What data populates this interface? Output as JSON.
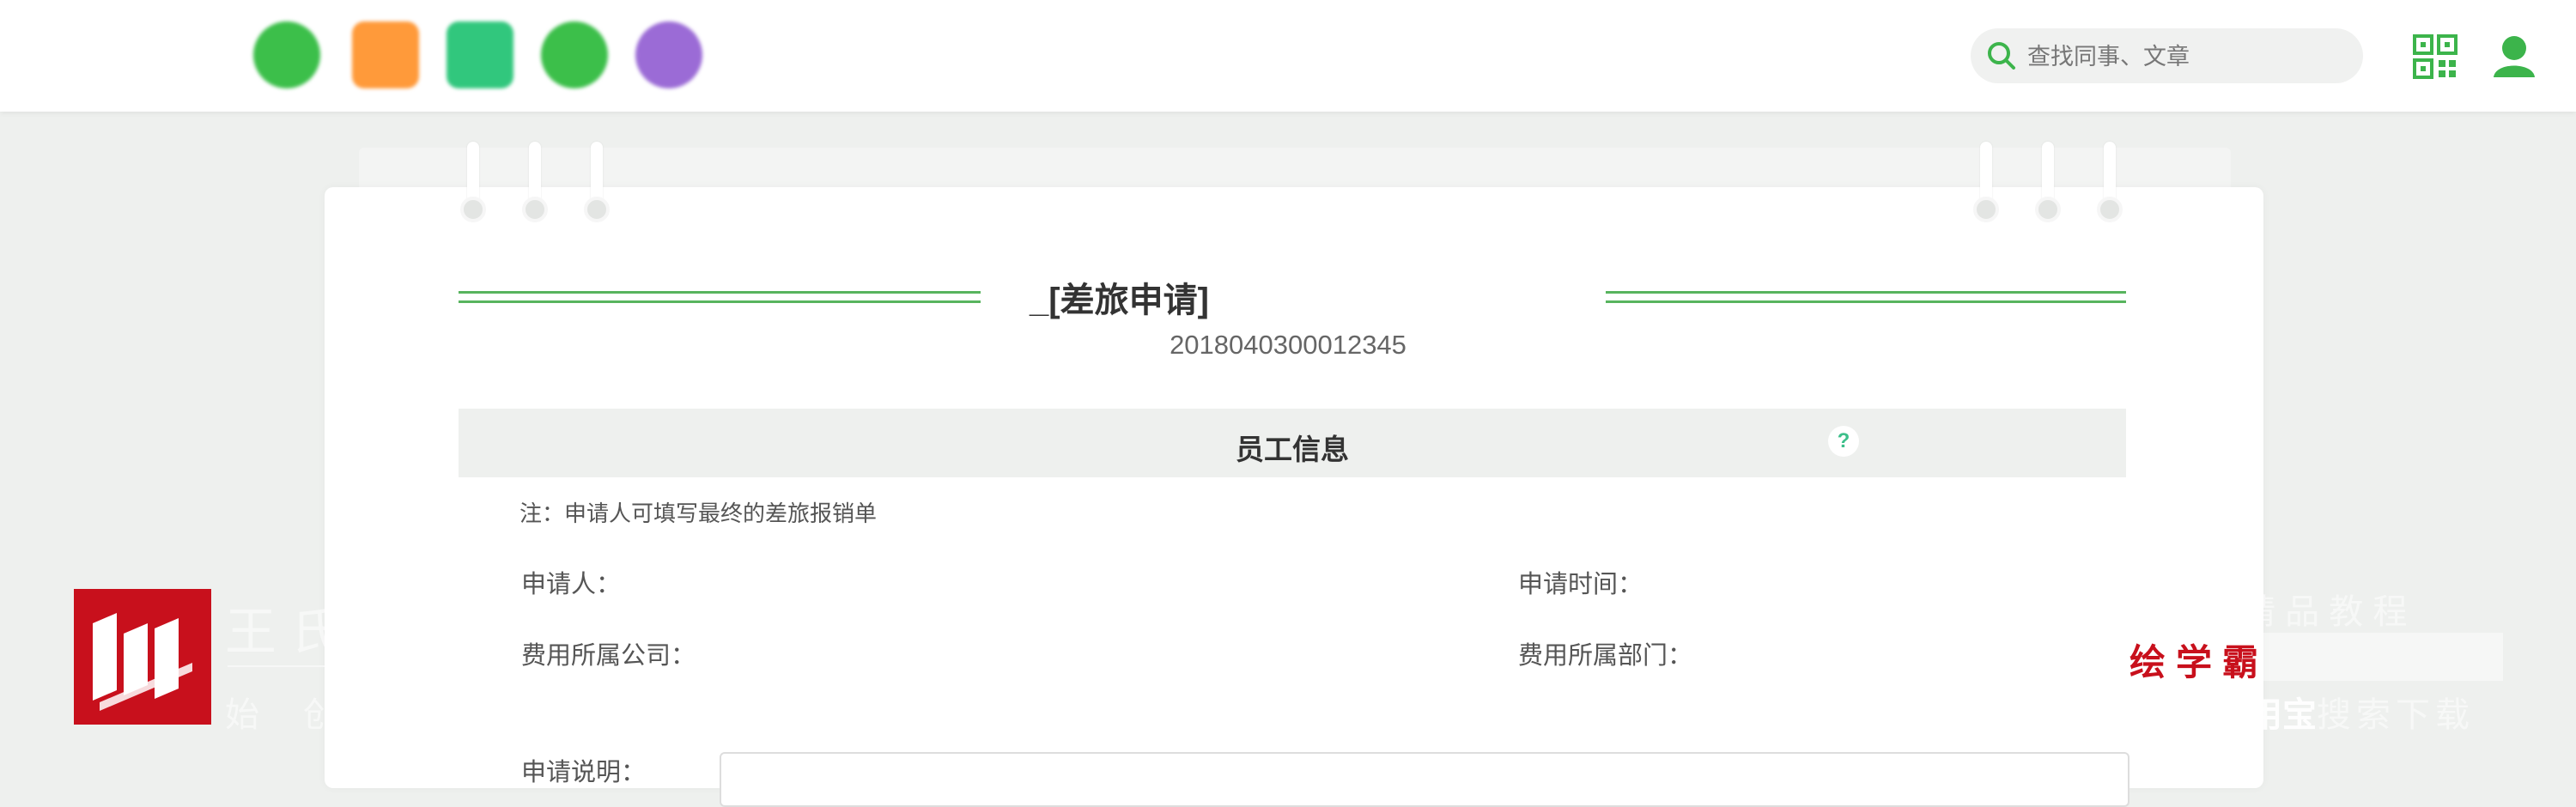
{
  "header": {
    "logo_text": "",
    "tagline": "",
    "tagline_highlight": "",
    "search_placeholder": "查找同事、文章"
  },
  "document": {
    "title_blurred": "",
    "title_suffix": "_[差旅申请]",
    "number": "2018040300012345"
  },
  "section": {
    "title": "员工信息",
    "help_symbol": "?"
  },
  "note": "注：申请人可填写最终的差旅报销单",
  "fields": {
    "applicant_label": "申请人：",
    "applicant_value": "",
    "apply_time_label": "申请时间：",
    "apply_time_value": "",
    "company_label": "费用所属公司：",
    "company_value": "",
    "company_value_2": "",
    "department_label": "费用所属部门：",
    "department_value": "",
    "description_label": "申请说明："
  },
  "watermark": {
    "title": "王 氏",
    "subtitle": "始 创",
    "right_top": "精 品 教 程",
    "brand_red": "绘学霸",
    "brand_bold": "用宝",
    "brand_tail": "搜索下载"
  },
  "colors": {
    "accent": "#3cb44b",
    "watermark_red": "#c8101c",
    "app_icons": [
      "#3cbf4a",
      "#ff9a3a",
      "#31c77d",
      "#3cbf4a",
      "#9b6bd6"
    ]
  }
}
